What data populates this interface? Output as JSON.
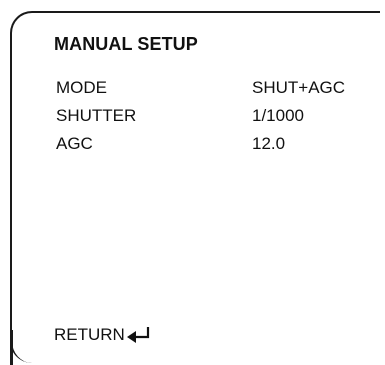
{
  "menu": {
    "title": "MANUAL SETUP",
    "items": [
      {
        "label": "MODE",
        "value": "SHUT+AGC"
      },
      {
        "label": "SHUTTER",
        "value": "1/1000"
      },
      {
        "label": "AGC",
        "value": "12.0"
      }
    ],
    "return_label": "RETURN",
    "return_icon": "enter-arrow-icon"
  }
}
